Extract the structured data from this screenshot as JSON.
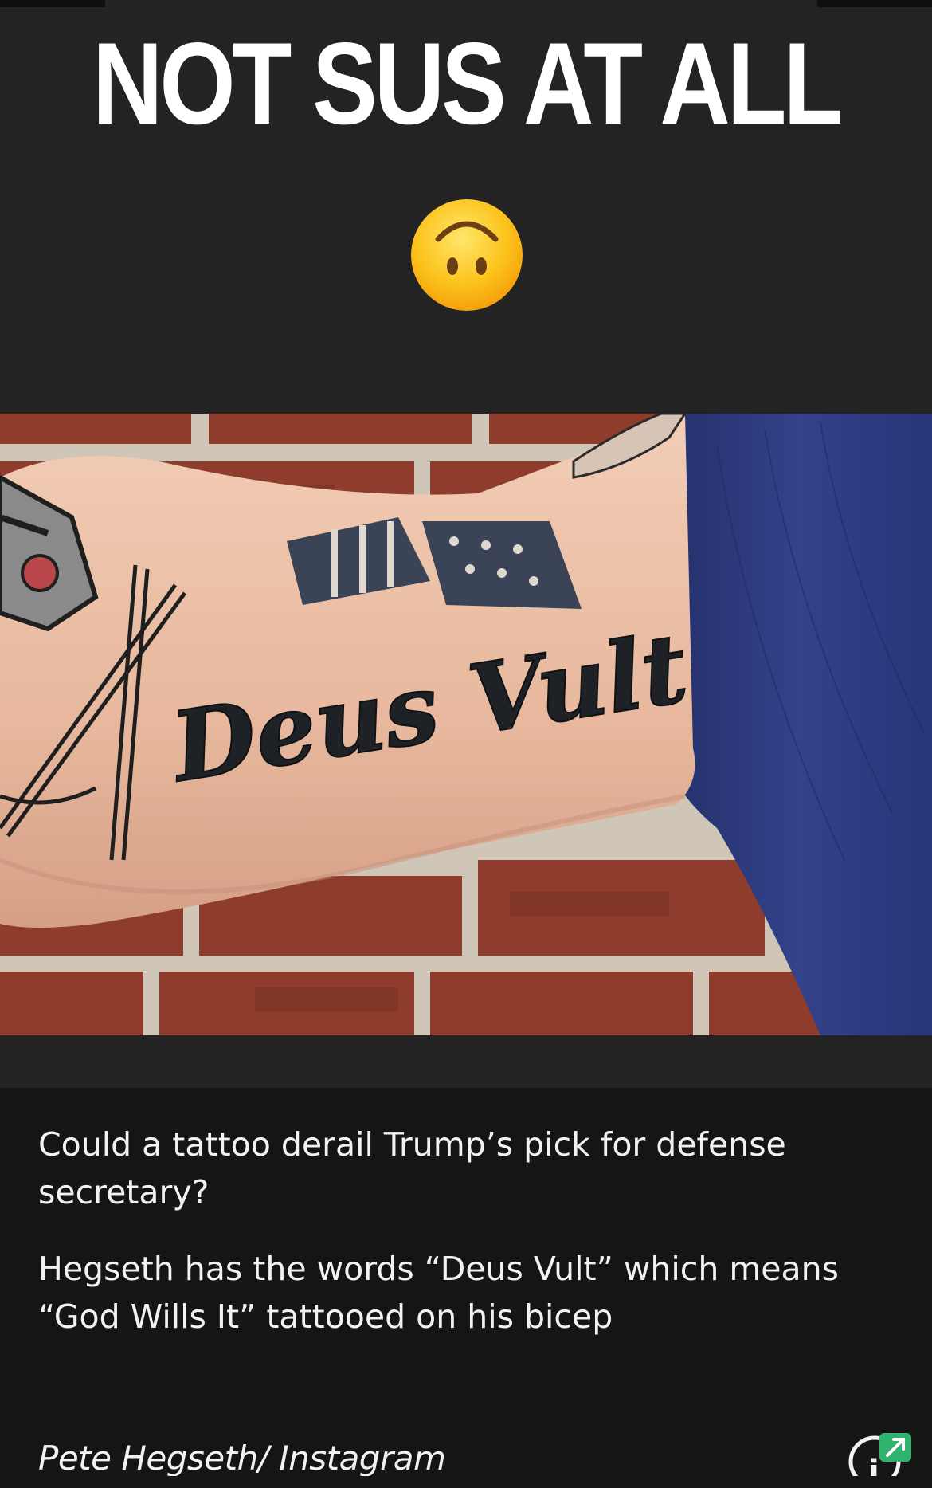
{
  "headline": "NOT SUS AT ALL",
  "emoji": "upside-down-face-icon",
  "photo": {
    "tattoo_text": "Deus Vult"
  },
  "caption": {
    "question": "Could a tattoo derail Trump’s pick for defense secretary?",
    "body": "Hegseth has the words “Deus Vult” which means “God Wills It” tattooed on his bicep",
    "credit": "Pete Hegseth/ Instagram"
  },
  "info_button": "info-icon",
  "colors": {
    "top_background": "#232324",
    "caption_background": "#151515",
    "text": "#ffffff",
    "brick": "#8a3a2c",
    "shirt": "#2c3a78",
    "skin": "#e8bea6"
  }
}
